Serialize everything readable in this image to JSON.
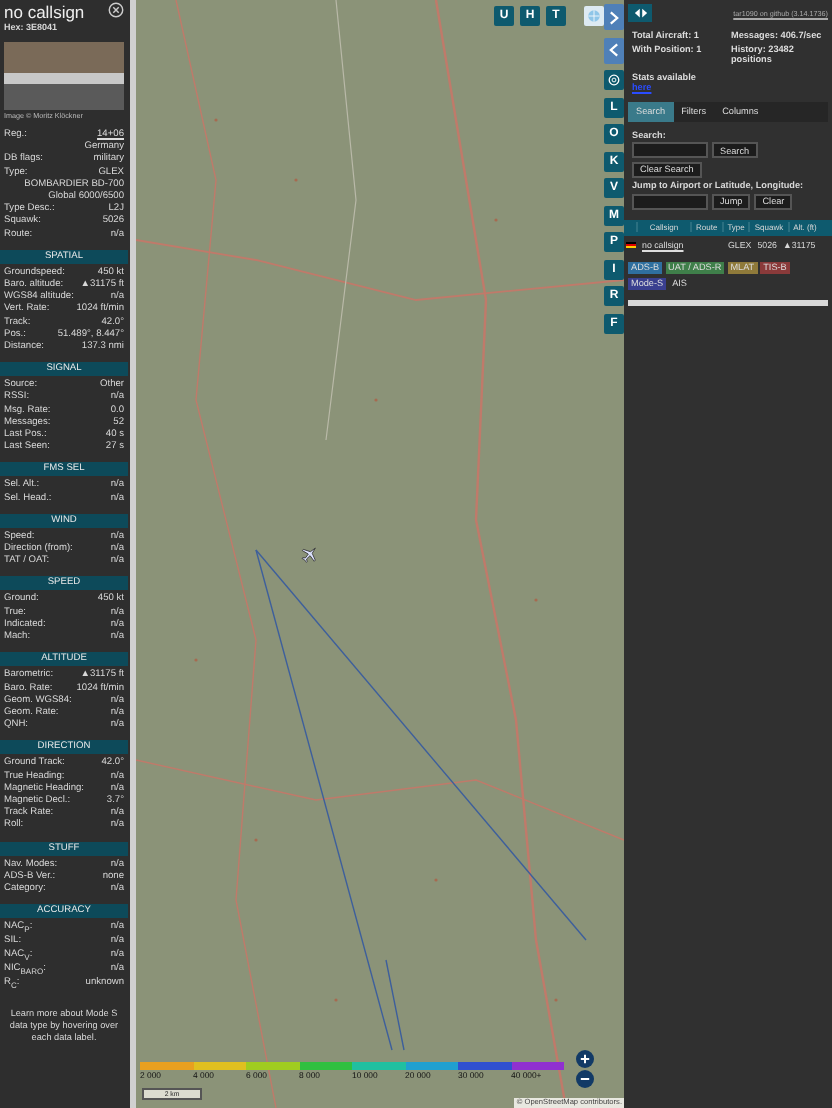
{
  "aircraft_panel": {
    "title": "no callsign",
    "hex": "Hex: 3E8041",
    "photo_credit": "Image © Moritz Klöckner",
    "rows": [
      {
        "kind": "link",
        "label": "Reg.:",
        "value": "14+06"
      },
      {
        "kind": "value",
        "value": "Germany"
      },
      {
        "kind": "pair",
        "label": "DB flags:",
        "value": "military"
      },
      {
        "kind": "pair",
        "label": "Type:",
        "value": "GLEX"
      },
      {
        "kind": "value",
        "value": "BOMBARDIER BD-700 Global 6000/6500"
      },
      {
        "kind": "pair",
        "label": "Type Desc.:",
        "value": "L2J"
      },
      {
        "kind": "pair",
        "label": "Squawk:",
        "value": "5026"
      },
      {
        "kind": "pair",
        "label": "Route:",
        "value": "n/a"
      }
    ],
    "sections": [
      {
        "title": "SPATIAL",
        "rows": [
          {
            "label": "Groundspeed:",
            "value": "450 kt"
          },
          {
            "label": "Baro. altitude:",
            "value": "▲31175 ft"
          },
          {
            "label": "WGS84 altitude:",
            "value": "n/a"
          },
          {
            "label": "Vert. Rate:",
            "value": "1024 ft/min"
          },
          {
            "label": "Track:",
            "value": "42.0°"
          },
          {
            "label": "Pos.:",
            "value": "51.489°, 8.447°"
          },
          {
            "label": "Distance:",
            "value": "137.3 nmi"
          }
        ]
      },
      {
        "title": "SIGNAL",
        "rows": [
          {
            "label": "Source:",
            "value": "Other"
          },
          {
            "label": "RSSI:",
            "value": "n/a"
          },
          {
            "label": "Msg. Rate:",
            "value": "0.0"
          },
          {
            "label": "Messages:",
            "value": "52"
          },
          {
            "label": "Last Pos.:",
            "value": "40 s"
          },
          {
            "label": "Last Seen:",
            "value": "27 s"
          }
        ]
      },
      {
        "title": "FMS SEL",
        "rows": [
          {
            "label": "Sel. Alt.:",
            "value": "n/a"
          },
          {
            "label": "Sel. Head.:",
            "value": "n/a"
          }
        ]
      },
      {
        "title": "WIND",
        "rows": [
          {
            "label": "Speed:",
            "value": "n/a"
          },
          {
            "label": "Direction (from):",
            "value": "n/a"
          },
          {
            "label": "TAT / OAT:",
            "value": "n/a"
          }
        ]
      },
      {
        "title": "SPEED",
        "rows": [
          {
            "label": "Ground:",
            "value": "450 kt"
          },
          {
            "label": "True:",
            "value": "n/a"
          },
          {
            "label": "Indicated:",
            "value": "n/a"
          },
          {
            "label": "Mach:",
            "value": "n/a"
          }
        ]
      },
      {
        "title": "ALTITUDE",
        "rows": [
          {
            "label": "Barometric:",
            "value": "▲31175 ft"
          },
          {
            "label": "Baro. Rate:",
            "value": "1024 ft/min"
          },
          {
            "label": "Geom. WGS84:",
            "value": "n/a"
          },
          {
            "label": "Geom. Rate:",
            "value": "n/a"
          },
          {
            "label": "QNH:",
            "value": "n/a"
          }
        ]
      },
      {
        "title": "DIRECTION",
        "rows": [
          {
            "label": "Ground Track:",
            "value": "42.0°"
          },
          {
            "label": "True Heading:",
            "value": "n/a"
          },
          {
            "label": "Magnetic Heading:",
            "value": "n/a"
          },
          {
            "label": "Magnetic Decl.:",
            "value": "3.7°"
          },
          {
            "label": "Track Rate:",
            "value": "n/a"
          },
          {
            "label": "Roll:",
            "value": "n/a"
          }
        ]
      },
      {
        "title": "STUFF",
        "rows": [
          {
            "label": "Nav. Modes:",
            "value": "n/a"
          },
          {
            "label": "ADS-B Ver.:",
            "value": "none"
          },
          {
            "label": "Category:",
            "value": "n/a"
          }
        ]
      },
      {
        "title": "ACCURACY",
        "rows": [
          {
            "label": "NAC$_{P}$:",
            "value": "n/a"
          },
          {
            "label": "SIL:",
            "value": "n/a"
          },
          {
            "label": "NAC$_{V}$:",
            "value": "n/a"
          },
          {
            "label": "NIC$_{BARO}$:",
            "value": "n/a"
          },
          {
            "label": "R$_{C}$:",
            "value": "unknown"
          }
        ]
      }
    ],
    "footer": "Learn more about Mode S data type by hovering over each data label."
  },
  "map": {
    "top_buttons": [
      "U",
      "H",
      "T"
    ],
    "side_buttons": [
      "L",
      "O",
      "K",
      "V",
      "M",
      "P",
      "I",
      "R",
      "F"
    ],
    "altitude_legend": [
      "2 000",
      "4 000",
      "6 000",
      "8 000",
      "10 000",
      "20 000",
      "30 000",
      "40 000+"
    ],
    "scale": "2 km",
    "attribution": "© OpenStreetMap contributors."
  },
  "side_panel": {
    "github_link": "tar1090 on github (3.14.1736)",
    "stats": [
      {
        "label": "Total Aircraft: 1"
      },
      {
        "label": "Messages: 406.7/sec"
      },
      {
        "label": "With Position: 1"
      },
      {
        "label": "History: 23482 positions"
      }
    ],
    "stats_text": "Stats available",
    "stats_link": "here",
    "tabs": [
      {
        "label": "Search",
        "selected": true
      },
      {
        "label": "Filters",
        "selected": false
      },
      {
        "label": "Columns",
        "selected": false
      }
    ],
    "search_label": "Search:",
    "search_button": "Search",
    "clear_search_button": "Clear Search",
    "jump_label": "Jump to Airport or Latitude, Longitude:",
    "jump_button": "Jump",
    "clear_button": "Clear",
    "table": {
      "columns": [
        "Callsign",
        "Route",
        "Type",
        "Squawk",
        "Alt. (ft)"
      ],
      "rows": [
        {
          "callsign": "no callsign",
          "type": "GLEX",
          "squawk": "5026",
          "altitude": "▲31175"
        }
      ]
    },
    "sources": [
      {
        "label": "ADS-B",
        "color": "#2f6f9f"
      },
      {
        "label": "UAT / ADS-R",
        "color": "#3f7f4a"
      },
      {
        "label": "MLAT",
        "color": "#8f7a3a"
      },
      {
        "label": "TIS-B",
        "color": "#8a3a3a"
      },
      {
        "label": "Mode-S",
        "color": "#3a3f8f"
      },
      {
        "label": "AIS",
        "color": "#2e2e2e"
      }
    ]
  }
}
